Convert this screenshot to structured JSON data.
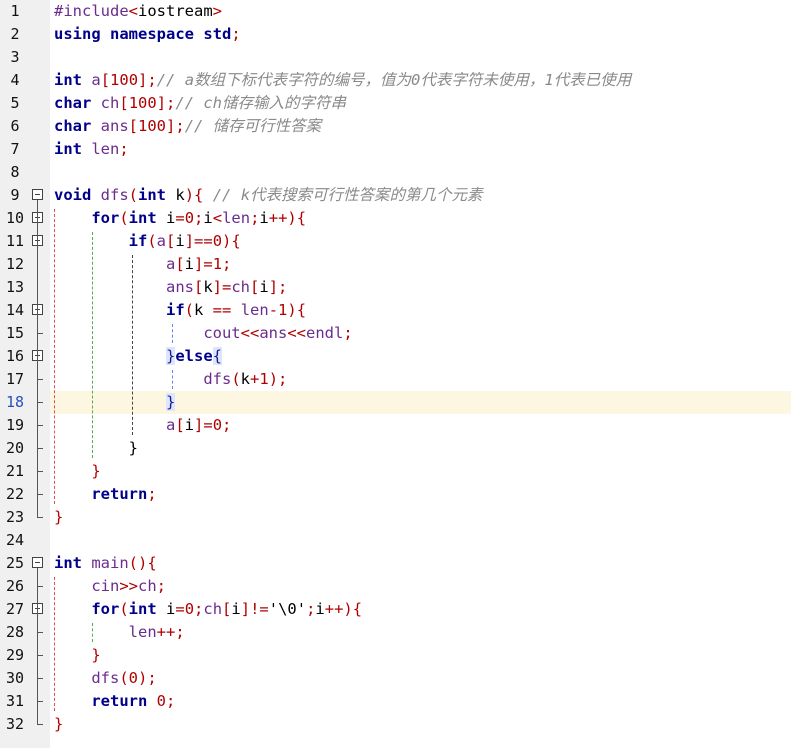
{
  "editor": {
    "active_line": 18,
    "lines": [
      {
        "n": "1",
        "tokens": [
          [
            "pp",
            "#include"
          ],
          [
            "op",
            "<"
          ],
          [
            "id",
            "iostream"
          ],
          [
            "op",
            ">"
          ]
        ]
      },
      {
        "n": "2",
        "tokens": [
          [
            "kw",
            "using"
          ],
          [
            "id",
            " "
          ],
          [
            "kw",
            "namespace"
          ],
          [
            "id",
            " "
          ],
          [
            "kw",
            "std"
          ],
          [
            "op",
            ";"
          ]
        ]
      },
      {
        "n": "3",
        "tokens": []
      },
      {
        "n": "4",
        "tokens": [
          [
            "kw",
            "int"
          ],
          [
            "id",
            " "
          ],
          [
            "var",
            "a"
          ],
          [
            "op",
            "["
          ],
          [
            "num",
            "100"
          ],
          [
            "op",
            "];"
          ],
          [
            "cmt",
            "// a数组下标代表字符的编号，值为0代表字符未使用，1代表已使用"
          ]
        ]
      },
      {
        "n": "5",
        "tokens": [
          [
            "kw",
            "char"
          ],
          [
            "id",
            " "
          ],
          [
            "var",
            "ch"
          ],
          [
            "op",
            "["
          ],
          [
            "num",
            "100"
          ],
          [
            "op",
            "];"
          ],
          [
            "cmt",
            "// ch储存输入的字符串"
          ]
        ]
      },
      {
        "n": "6",
        "tokens": [
          [
            "kw",
            "char"
          ],
          [
            "id",
            " "
          ],
          [
            "var",
            "ans"
          ],
          [
            "op",
            "["
          ],
          [
            "num",
            "100"
          ],
          [
            "op",
            "];"
          ],
          [
            "cmt",
            "// 储存可行性答案"
          ]
        ]
      },
      {
        "n": "7",
        "tokens": [
          [
            "kw",
            "int"
          ],
          [
            "id",
            " "
          ],
          [
            "var",
            "len"
          ],
          [
            "op",
            ";"
          ]
        ]
      },
      {
        "n": "8",
        "tokens": []
      },
      {
        "n": "9",
        "tokens": [
          [
            "kw",
            "void"
          ],
          [
            "id",
            " "
          ],
          [
            "var",
            "dfs"
          ],
          [
            "op",
            "("
          ],
          [
            "kw",
            "int"
          ],
          [
            "id",
            " k"
          ],
          [
            "op",
            ")"
          ],
          [
            "op",
            "{"
          ],
          [
            "id",
            " "
          ],
          [
            "cmt",
            "// k代表搜索可行性答案的第几个元素"
          ]
        ]
      },
      {
        "n": "10",
        "tokens": [
          [
            "id",
            "    "
          ],
          [
            "kw",
            "for"
          ],
          [
            "op",
            "("
          ],
          [
            "kw",
            "int"
          ],
          [
            "id",
            " i"
          ],
          [
            "op",
            "="
          ],
          [
            "num",
            "0"
          ],
          [
            "op",
            ";"
          ],
          [
            "id",
            "i"
          ],
          [
            "op",
            "<"
          ],
          [
            "var",
            "len"
          ],
          [
            "op",
            ";"
          ],
          [
            "id",
            "i"
          ],
          [
            "op",
            "++"
          ],
          [
            "op",
            "){"
          ]
        ]
      },
      {
        "n": "11",
        "tokens": [
          [
            "id",
            "        "
          ],
          [
            "kw",
            "if"
          ],
          [
            "op",
            "("
          ],
          [
            "var",
            "a"
          ],
          [
            "op",
            "["
          ],
          [
            "id",
            "i"
          ],
          [
            "op",
            "]=="
          ],
          [
            "num",
            "0"
          ],
          [
            "op",
            "){"
          ]
        ]
      },
      {
        "n": "12",
        "tokens": [
          [
            "id",
            "            "
          ],
          [
            "var",
            "a"
          ],
          [
            "op",
            "["
          ],
          [
            "id",
            "i"
          ],
          [
            "op",
            "]="
          ],
          [
            "num",
            "1"
          ],
          [
            "op",
            ";"
          ]
        ]
      },
      {
        "n": "13",
        "tokens": [
          [
            "id",
            "            "
          ],
          [
            "var",
            "ans"
          ],
          [
            "op",
            "["
          ],
          [
            "id",
            "k"
          ],
          [
            "op",
            "]="
          ],
          [
            "var",
            "ch"
          ],
          [
            "op",
            "["
          ],
          [
            "id",
            "i"
          ],
          [
            "op",
            "];"
          ]
        ]
      },
      {
        "n": "14",
        "tokens": [
          [
            "id",
            "            "
          ],
          [
            "kw",
            "if"
          ],
          [
            "op",
            "("
          ],
          [
            "id",
            "k "
          ],
          [
            "op",
            "=="
          ],
          [
            "id",
            " "
          ],
          [
            "var",
            "len"
          ],
          [
            "op",
            "-"
          ],
          [
            "num",
            "1"
          ],
          [
            "op",
            "){"
          ]
        ]
      },
      {
        "n": "15",
        "tokens": [
          [
            "id",
            "                "
          ],
          [
            "var",
            "cout"
          ],
          [
            "op",
            "<<"
          ],
          [
            "var",
            "ans"
          ],
          [
            "op",
            "<<"
          ],
          [
            "var",
            "endl"
          ],
          [
            "op",
            ";"
          ]
        ]
      },
      {
        "n": "16",
        "tokens": [
          [
            "id",
            "            "
          ],
          [
            "hl",
            "}"
          ],
          [
            "kw",
            "else"
          ],
          [
            "hl",
            "{"
          ]
        ]
      },
      {
        "n": "17",
        "tokens": [
          [
            "id",
            "                "
          ],
          [
            "var",
            "dfs"
          ],
          [
            "op",
            "("
          ],
          [
            "id",
            "k"
          ],
          [
            "op",
            "+"
          ],
          [
            "num",
            "1"
          ],
          [
            "op",
            ");"
          ]
        ]
      },
      {
        "n": "18",
        "tokens": [
          [
            "id",
            "            "
          ],
          [
            "hl",
            "}"
          ]
        ]
      },
      {
        "n": "19",
        "tokens": [
          [
            "id",
            "            "
          ],
          [
            "var",
            "a"
          ],
          [
            "op",
            "["
          ],
          [
            "id",
            "i"
          ],
          [
            "op",
            "]="
          ],
          [
            "num",
            "0"
          ],
          [
            "op",
            ";"
          ]
        ]
      },
      {
        "n": "20",
        "tokens": [
          [
            "id",
            "        }"
          ]
        ]
      },
      {
        "n": "21",
        "tokens": [
          [
            "id",
            "    "
          ],
          [
            "op",
            "}"
          ]
        ]
      },
      {
        "n": "22",
        "tokens": [
          [
            "id",
            "    "
          ],
          [
            "kw",
            "return"
          ],
          [
            "op",
            ";"
          ]
        ]
      },
      {
        "n": "23",
        "tokens": [
          [
            "op",
            "}"
          ]
        ]
      },
      {
        "n": "24",
        "tokens": []
      },
      {
        "n": "25",
        "tokens": [
          [
            "kw",
            "int"
          ],
          [
            "id",
            " "
          ],
          [
            "var",
            "main"
          ],
          [
            "op",
            "(){"
          ]
        ]
      },
      {
        "n": "26",
        "tokens": [
          [
            "id",
            "    "
          ],
          [
            "var",
            "cin"
          ],
          [
            "op",
            ">>"
          ],
          [
            "var",
            "ch"
          ],
          [
            "op",
            ";"
          ]
        ]
      },
      {
        "n": "27",
        "tokens": [
          [
            "id",
            "    "
          ],
          [
            "kw",
            "for"
          ],
          [
            "op",
            "("
          ],
          [
            "kw",
            "int"
          ],
          [
            "id",
            " i"
          ],
          [
            "op",
            "="
          ],
          [
            "num",
            "0"
          ],
          [
            "op",
            ";"
          ],
          [
            "var",
            "ch"
          ],
          [
            "op",
            "["
          ],
          [
            "id",
            "i"
          ],
          [
            "op",
            "]!="
          ],
          [
            "id",
            "'\\0'"
          ],
          [
            "op",
            ";"
          ],
          [
            "id",
            "i"
          ],
          [
            "op",
            "++"
          ],
          [
            "op",
            "){"
          ]
        ]
      },
      {
        "n": "28",
        "tokens": [
          [
            "id",
            "        "
          ],
          [
            "var",
            "len"
          ],
          [
            "op",
            "++"
          ],
          [
            "op",
            ";"
          ]
        ]
      },
      {
        "n": "29",
        "tokens": [
          [
            "id",
            "    "
          ],
          [
            "op",
            "}"
          ]
        ]
      },
      {
        "n": "30",
        "tokens": [
          [
            "id",
            "    "
          ],
          [
            "var",
            "dfs"
          ],
          [
            "op",
            "("
          ],
          [
            "num",
            "0"
          ],
          [
            "op",
            ");"
          ]
        ]
      },
      {
        "n": "31",
        "tokens": [
          [
            "id",
            "    "
          ],
          [
            "kw",
            "return"
          ],
          [
            "id",
            " "
          ],
          [
            "num",
            "0"
          ],
          [
            "op",
            ";"
          ]
        ]
      },
      {
        "n": "32",
        "tokens": [
          [
            "op",
            "}"
          ]
        ]
      }
    ]
  }
}
